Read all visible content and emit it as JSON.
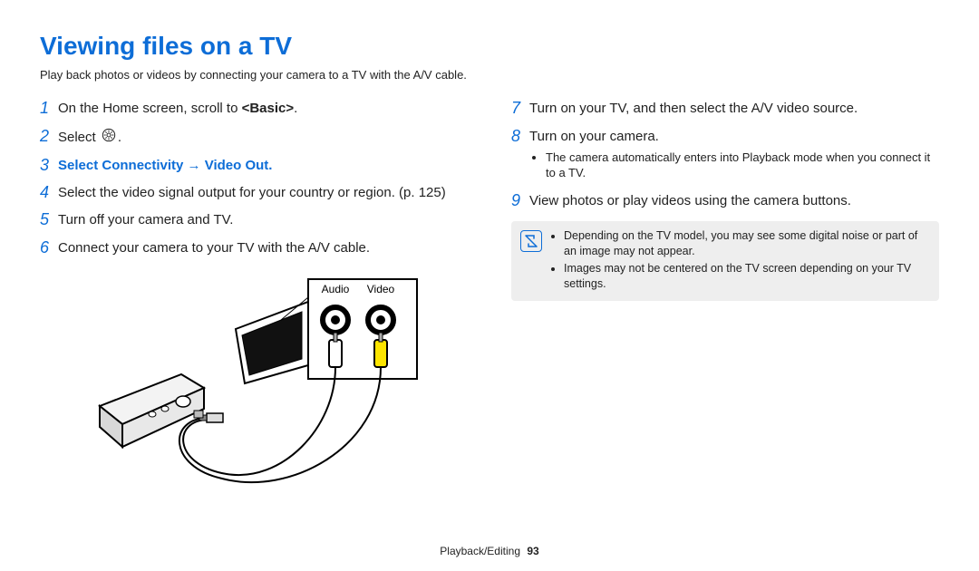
{
  "title": "Viewing files on a TV",
  "subtitle": "Play back photos or videos by connecting your camera to a TV with the A/V cable.",
  "left_steps": [
    {
      "n": "1",
      "text_pre": "On the Home screen, scroll to ",
      "bold": "<Basic>",
      "text_post": "."
    },
    {
      "n": "2",
      "text_pre": "Select ",
      "icon": "gear",
      "text_post": "."
    },
    {
      "n": "3",
      "diff": true,
      "text_pre": "Select ",
      "bold": "Connectivity → Video Out",
      "text_post": "."
    },
    {
      "n": "4",
      "text_pre": "Select the video signal output for your country or region. (p. 125)"
    },
    {
      "n": "5",
      "text_pre": "Turn off your camera and TV."
    },
    {
      "n": "6",
      "text_pre": "Connect your camera to your TV with the A/V cable."
    }
  ],
  "right_steps": [
    {
      "n": "7",
      "text_pre": "Turn on your TV, and then select the A/V video source."
    },
    {
      "n": "8",
      "text_pre": "Turn on your camera.",
      "sub": [
        "The camera automatically enters into Playback mode when you connect it to a TV."
      ]
    },
    {
      "n": "9",
      "text_pre": "View photos or play videos using the camera buttons."
    }
  ],
  "notes": [
    "Depending on the TV model, you may see some digital noise or part of an image may not appear.",
    "Images may not be centered on the TV screen depending on your TV settings."
  ],
  "illus": {
    "audio_label": "Audio",
    "video_label": "Video"
  },
  "footer": {
    "section": "Playback/Editing",
    "page": "93"
  }
}
